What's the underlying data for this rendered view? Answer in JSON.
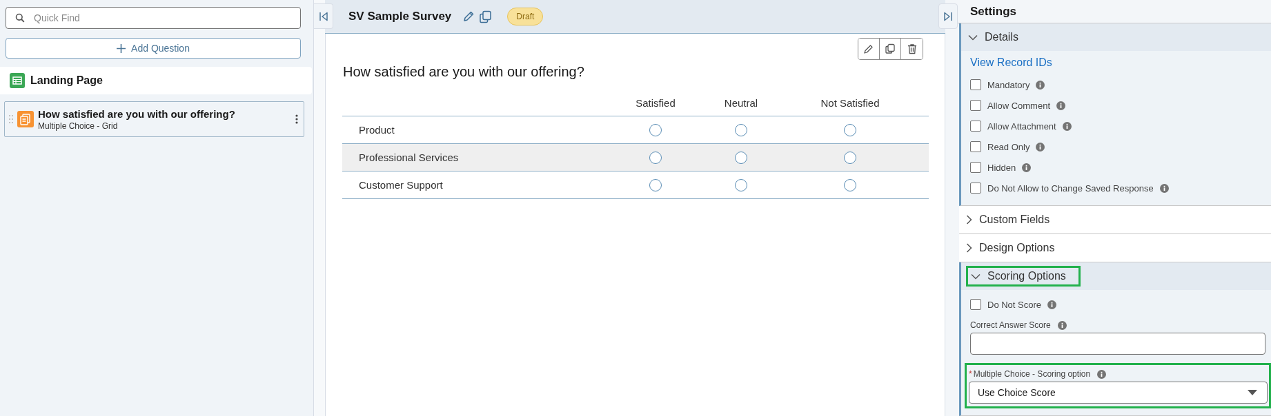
{
  "sidebar": {
    "search": {
      "placeholder": "Quick Find"
    },
    "add_button": {
      "label": "Add Question"
    },
    "pages": [
      {
        "title": "Landing Page",
        "questions": [
          {
            "title": "How satisfied are you with our offering?",
            "type": "Multiple Choice - Grid",
            "selected": false
          }
        ]
      }
    ]
  },
  "survey": {
    "title": "SV Sample Survey",
    "status": "Draft"
  },
  "question": {
    "text": "How satisfied are you with our offering?",
    "columns": [
      "Satisfied",
      "Neutral",
      "Not Satisfied"
    ],
    "rows": [
      {
        "label": "Product",
        "highlighted": false,
        "choices": [
          {
            "selected": false
          },
          {
            "selected": false
          },
          {
            "selected": false
          }
        ]
      },
      {
        "label": "Professional Services",
        "highlighted": true,
        "choices": [
          {
            "selected": false
          },
          {
            "selected": false
          },
          {
            "selected": false
          }
        ]
      },
      {
        "label": "Customer Support",
        "highlighted": false,
        "choices": [
          {
            "selected": false
          },
          {
            "selected": false
          },
          {
            "selected": false
          }
        ]
      }
    ]
  },
  "settings": {
    "title": "Settings",
    "sections": [
      {
        "title": "Details",
        "expanded": true,
        "highlighted": false,
        "link": "View Record IDs",
        "options": [
          {
            "label": "Mandatory",
            "checked": false
          },
          {
            "label": "Allow Comment",
            "checked": false
          },
          {
            "label": "Allow Attachment",
            "checked": false
          },
          {
            "label": "Read Only",
            "checked": false
          },
          {
            "label": "Hidden",
            "checked": false
          },
          {
            "label": "Do Not Allow to Change Saved Response",
            "checked": false
          }
        ]
      },
      {
        "title": "Custom Fields",
        "expanded": false,
        "highlighted": false
      },
      {
        "title": "Design Options",
        "expanded": false,
        "highlighted": false
      },
      {
        "title": "Scoring Options",
        "expanded": true,
        "highlighted": true,
        "options": [
          {
            "label": "Do Not Score",
            "checked": false
          }
        ],
        "fields": [
          {
            "kind": "text",
            "label": "Correct Answer Score",
            "highlighted": false
          },
          {
            "kind": "select",
            "label": "Multiple Choice - Scoring option",
            "required_mark": "*",
            "value": "Use Choice Score",
            "highlighted": true
          }
        ]
      }
    ]
  }
}
